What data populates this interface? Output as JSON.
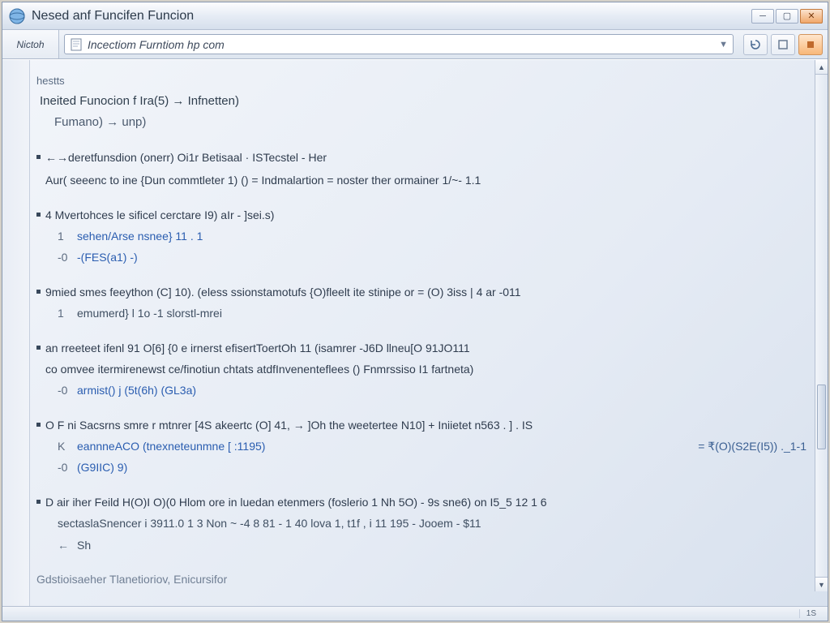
{
  "window": {
    "title": "Nesed anf Funcifen Funcion"
  },
  "toolbar": {
    "tab_label": "Nictoh",
    "address": "Incectiom Furntiom hp com"
  },
  "page": {
    "kicker": "hestts",
    "header_line": "Ineited Funocion f Ira(5) → Infnetten)",
    "header_sub": "Fumano) → unp)",
    "blocks": [
      {
        "lead": "←→deretfunsdion (onerr) Oi1r Betisaal · ISTecstel - Her",
        "sub": "Aur( seeenc to ine {Dun commtleter 1) () = Indmalartion = noster ther ormainer 1/~- 1.1"
      },
      {
        "lead": "4 Mvertohces le sificel cerctare I9) aIr - ]sei.s)",
        "code": [
          {
            "pre": "1  ",
            "text": "sehen/Arse nsnee} 11 . 1",
            "cls": "kw-blue"
          },
          {
            "pre": "-0 ",
            "text": "-(FES(a1)  -)",
            "cls": "kw-blue"
          }
        ]
      },
      {
        "lead": "9mied smes feeython (C] 10). (eless ssionstamotufs {O)fleelt ite stinipe or = (O) 3iss | 4 ar -011",
        "code": [
          {
            "pre": "1  ",
            "text": "emumerd} l 1o -1 slorstl-mrei",
            "cls": ""
          }
        ]
      },
      {
        "lead": "an rreeteet ifenl 91 O[6] {0 e irnerst efisertToertOh 11  (isamrer -J6D llneu[O 91JO111",
        "sub": "co omvee itermirenewst ce/finotiun chtats atdfInvenenteflees () Fnmrssiso I1 fartneta)",
        "code": [
          {
            "pre": "-0 ",
            "text": "armist() j (5t(6h) (GL3a)",
            "cls": "kw-blue"
          }
        ]
      },
      {
        "lead": "O F ni Sacsrns smre r mtnrer [4S akeertc (O] 41,  → ]Oh the weetertee N10] + Iniietet n563 . ] . IS",
        "code": [
          {
            "pre": "K  ",
            "text": "eannneACO (tnexneteunmne [ :1195)",
            "cls": "kw-blue",
            "right": "= ₹(O)(S2E(I5)) ._1-1"
          },
          {
            "pre": "-0 ",
            "text": "(G9IIC) 9)",
            "cls": "kw-blue"
          }
        ]
      },
      {
        "lead": "D air iher Feild H(O)I O)(0 Hlom ore in luedan etenmers (foslerio 1 Nh 5O) - 9s sne6) on I5_5 12 1 6",
        "sub_main": "sectaslaSnencer i 3911.0   1 3 Non ~ -4  8 81 - 1 40 lova 1, t1f , i 11 195 - Jooem - $11",
        "code": [
          {
            "pre": "←  ",
            "text": "Sh",
            "cls": ""
          }
        ]
      }
    ],
    "footer_line": "Gdstioisaeher Tlanetioriov, Enicursifor"
  },
  "status": {
    "right": "1S"
  }
}
